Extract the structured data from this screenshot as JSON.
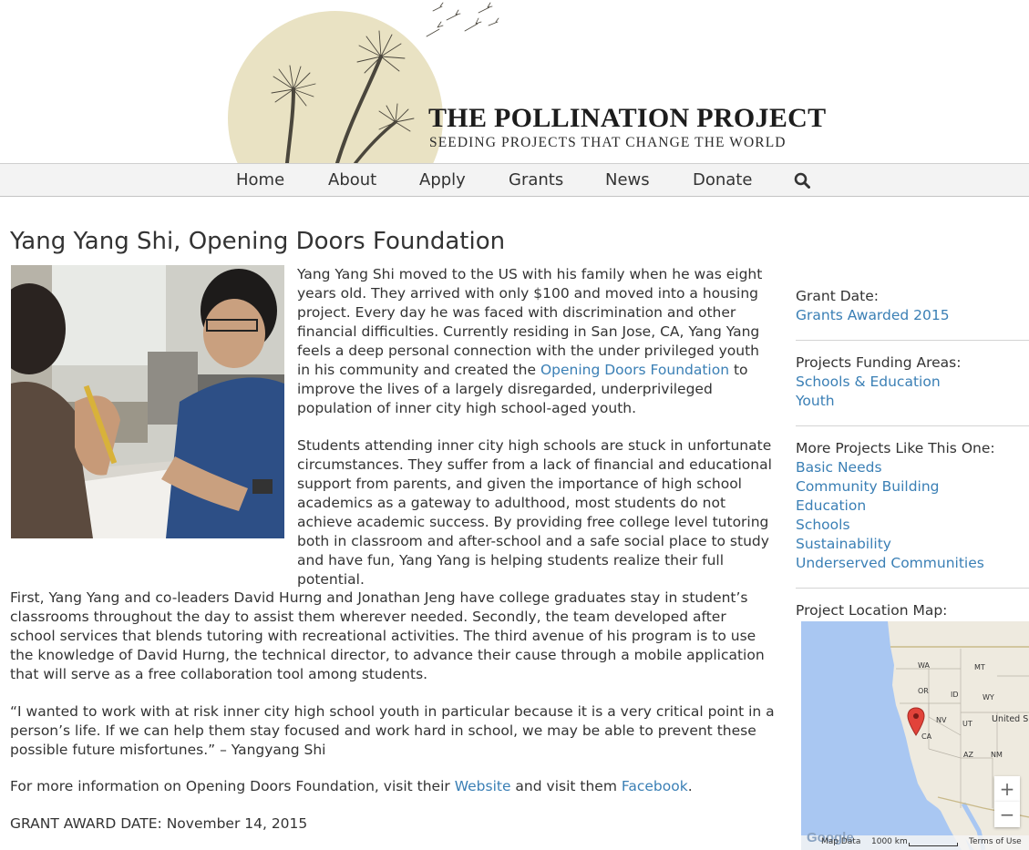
{
  "header": {
    "title": "THE POLLINATION PROJECT",
    "tagline": "SEEDING PROJECTS THAT CHANGE THE WORLD"
  },
  "nav": {
    "items": [
      "Home",
      "About",
      "Apply",
      "Grants",
      "News",
      "Donate"
    ],
    "search_icon": "search-icon"
  },
  "page": {
    "title": "Yang Yang Shi, Opening Doors Foundation",
    "p1_before": "Yang Yang Shi moved to the US with his family when he was eight years old. They arrived with only $100 and moved into a housing project. Every day he was faced with discrimination and other financial difficulties. Currently residing in San Jose, CA, Yang Yang feels a deep personal connection with the under privileged youth in his community and created the ",
    "p1_link": "Opening Doors Foundation",
    "p1_after": " to improve the lives of a largely disregarded, underprivileged population of inner city high school-aged youth.",
    "p2": "Students attending inner city high schools are stuck in unfortunate circumstances. They suffer from a lack of financial and educational support from parents, and given the importance of high school academics as a gateway to adulthood, most students do not achieve academic success. By providing free college level tutoring both in classroom and after-school and a safe social place to study and have fun, Yang Yang is helping students realize their full potential.",
    "p3": "First, Yang Yang and co-leaders David Hurng and Jonathan Jeng have college graduates stay in student’s classrooms throughout the day to assist them wherever needed. Secondly, the team developed after school services that blends tutoring with recreational activities. The third avenue of his program is to use the knowledge of David Hurng, the technical director, to advance their cause through a mobile application that will serve as a free collaboration tool among students.",
    "p4": "“I wanted to work with at risk inner city high school youth in particular because it is a very critical point in a person’s life. If we can help them stay focused and work hard in school, we may be able to prevent these possible future misfortunes.” – Yangyang Shi",
    "p5_before": "For more information on Opening Doors Foundation, visit their ",
    "p5_link1": "Website",
    "p5_middle": " and visit them ",
    "p5_link2": "Facebook",
    "p5_after": ".",
    "p6": "GRANT AWARD DATE: November 14, 2015"
  },
  "sidebar": {
    "grant_date_label": "Grant Date:",
    "grant_date_link": "Grants Awarded 2015",
    "funding_label": "Projects Funding Areas:",
    "funding_links": [
      "Schools & Education",
      "Youth"
    ],
    "similar_label": "More Projects Like This One:",
    "similar_links": [
      "Basic Needs",
      "Community Building",
      "Education",
      "Schools",
      "Sustainability",
      "Underserved Communities"
    ],
    "map_label": "Project Location Map:"
  },
  "map": {
    "state_labels": [
      "WA",
      "MT",
      "OR",
      "ID",
      "WY",
      "NV",
      "UT",
      "CA",
      "AZ",
      "NM"
    ],
    "country_label": "United S",
    "zoom_in": "+",
    "zoom_out": "−",
    "logo": "Google",
    "attribution": "Map Data",
    "scale": "1000 km",
    "terms": "Terms of Use",
    "colors": {
      "water": "#a9c7f2",
      "land": "#eeeadf",
      "marker": "#e2433a"
    }
  }
}
